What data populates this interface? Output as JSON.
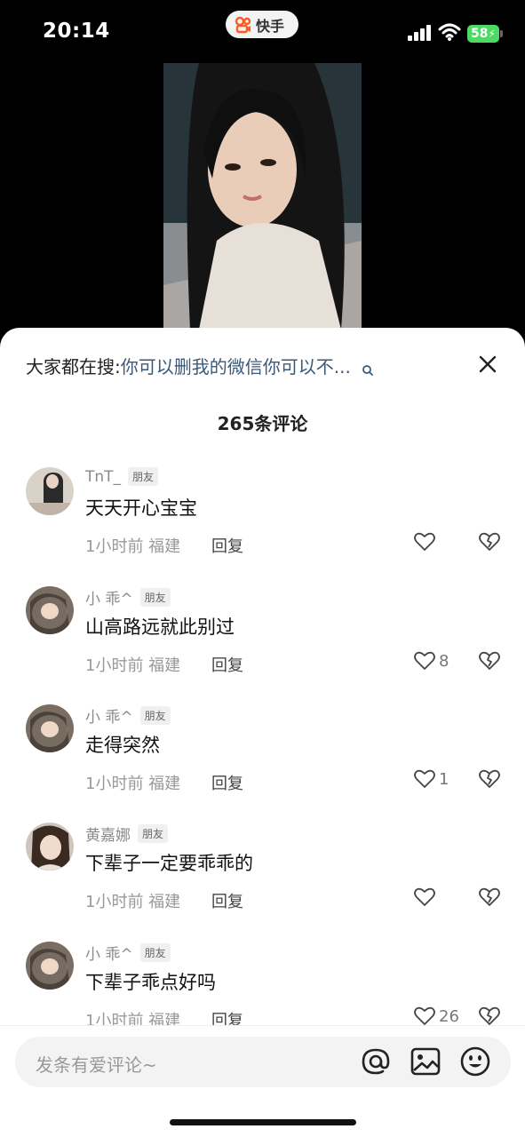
{
  "status_bar": {
    "time": "20:14",
    "app_name": "快手",
    "battery": "58"
  },
  "search": {
    "prefix": "大家都在搜:",
    "term": "你可以删我的微信你可以不..."
  },
  "comment_count": "265条评论",
  "comments": [
    {
      "username": "TnT_",
      "badge": "朋友",
      "text": "天天开心宝宝",
      "meta": "1小时前 福建",
      "reply": "回复",
      "likes": ""
    },
    {
      "username": "小 乖^",
      "badge": "朋友",
      "text": "山高路远就此别过",
      "meta": "1小时前 福建",
      "reply": "回复",
      "likes": "8"
    },
    {
      "username": "小 乖^",
      "badge": "朋友",
      "text": "走得突然",
      "meta": "1小时前 福建",
      "reply": "回复",
      "likes": "1"
    },
    {
      "username": "黄嘉娜",
      "badge": "朋友",
      "text": "下辈子一定要乖乖的",
      "meta": "1小时前 福建",
      "reply": "回复",
      "likes": ""
    },
    {
      "username": "小 乖^",
      "badge": "朋友",
      "text": "下辈子乖点好吗",
      "meta": "1小时前 福建",
      "reply": "回复",
      "likes": "26"
    }
  ],
  "input": {
    "placeholder": "发条有爱评论~"
  },
  "colors": {
    "accent_orange": "#ff5a1f",
    "link_blue": "#3b5a7a",
    "battery_green": "#4cd964"
  }
}
